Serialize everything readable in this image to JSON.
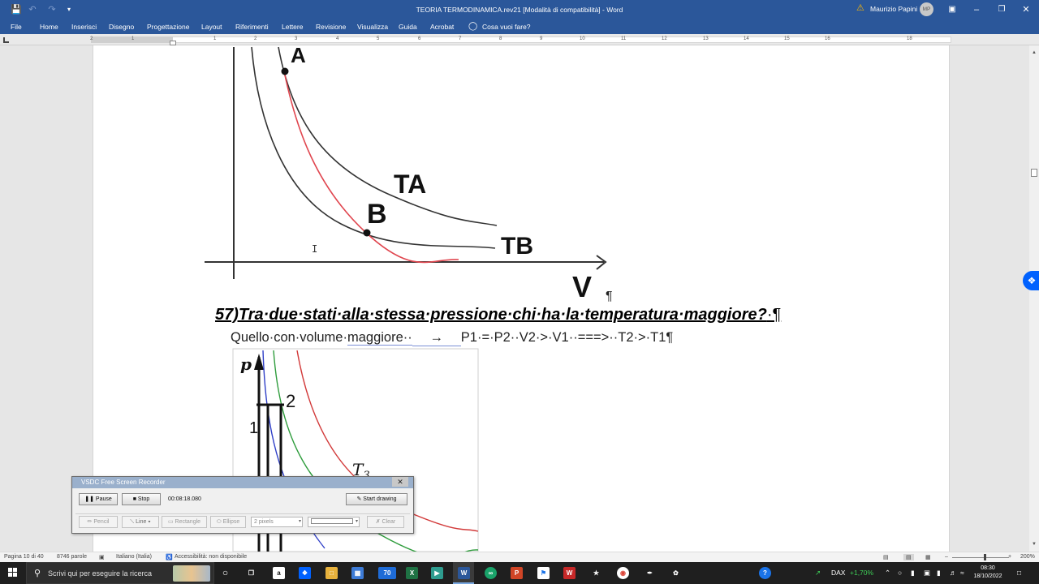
{
  "window": {
    "title": "TEORIA TERMODINAMICA.rev21 [Modalità di compatibilità]  -  Word",
    "user": "Maurizio Papini",
    "user_initials": "MP"
  },
  "ribbon": {
    "tabs": [
      "File",
      "Home",
      "Inserisci",
      "Disegno",
      "Progettazione",
      "Layout",
      "Riferimenti",
      "Lettere",
      "Revisione",
      "Visualizza",
      "Guida",
      "Acrobat"
    ],
    "tell_me": "Cosa vuoi fare?"
  },
  "ruler": {
    "numbers": [
      "2",
      "1",
      "1",
      "2",
      "3",
      "4",
      "5",
      "6",
      "7",
      "8",
      "9",
      "10",
      "11",
      "12",
      "13",
      "14",
      "15",
      "16",
      "18"
    ]
  },
  "figure1": {
    "label_A": "A",
    "label_B": "B",
    "label_TA": "TA",
    "label_TB": "TB",
    "axis_V": "V",
    "colors": {
      "isotherm": "#333333",
      "adiabat": "#e0464f"
    }
  },
  "document": {
    "heading": "57)Tra·due·stati·alla·stessa·pressione·chi·ha·la·temperatura·maggiore?",
    "heading_pilcrow": "·¶",
    "pilcrow_after_figure": "¶",
    "answer_part1": "Quello·con·volume·",
    "answer_part2": "maggiore··",
    "answer_arrow": "→",
    "answer_part3": "P1·=·P2··V2·>·V1··===>··T2·>·T1¶"
  },
  "figure2": {
    "axis_p": "p",
    "label_1": "1",
    "label_2": "2",
    "label_T3": "T",
    "label_T3_sub": "3",
    "colors": {
      "blue": "#2f3fc7",
      "green": "#2e9c3c",
      "red": "#d23a3a"
    }
  },
  "recorder": {
    "title": "VSDC Free Screen Recorder",
    "pause": "Pause",
    "stop": "Stop",
    "elapsed": "00:08:18.080",
    "start_drawing": "Start drawing",
    "pencil": "Pencil",
    "line": "Line",
    "rectangle": "Rectangle",
    "ellipse": "Ellipse",
    "width": "2 pixels",
    "clear": "Clear"
  },
  "statusbar": {
    "page": "Pagina 10 di 40",
    "words": "8746 parole",
    "language": "Italiano (Italia)",
    "accessibility": "Accessibilità: non disponibile",
    "zoom": "200%"
  },
  "taskbar": {
    "search_placeholder": "Scrivi qui per eseguire la ricerca",
    "mail_badge": "70",
    "stock_name": "DAX",
    "stock_change": "+1,70%",
    "time": "08:30",
    "date": "18/10/2022"
  }
}
